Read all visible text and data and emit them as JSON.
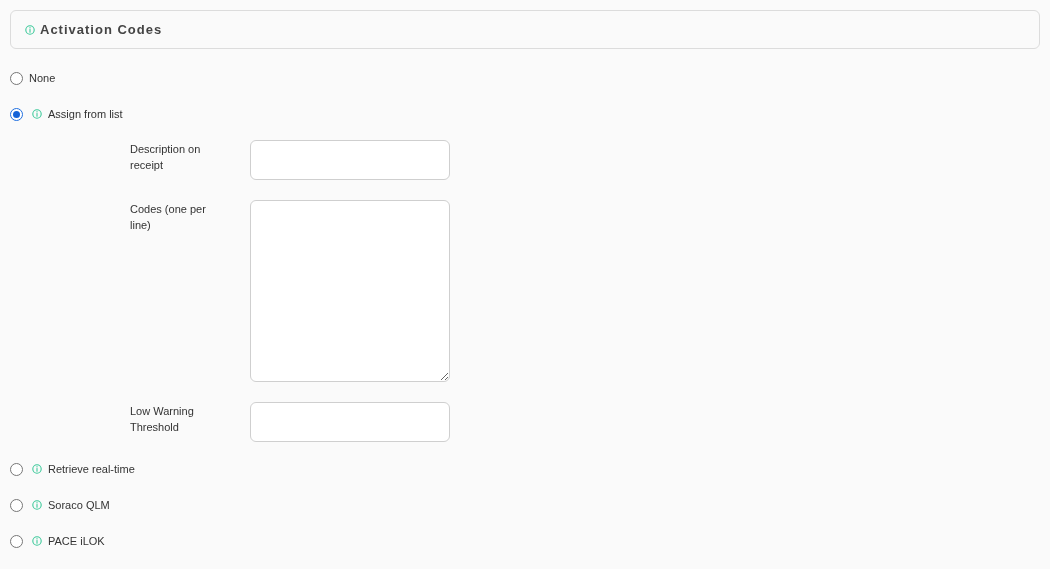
{
  "section": {
    "title": "Activation Codes",
    "info": true
  },
  "options": [
    {
      "label": "None",
      "info": false,
      "selected": false
    },
    {
      "label": "Assign from list",
      "info": true,
      "selected": true,
      "fields": [
        {
          "label": "Description on receipt",
          "kind": "input"
        },
        {
          "label": "Codes (one per line)",
          "kind": "textarea"
        },
        {
          "label": "Low Warning Threshold",
          "kind": "input"
        }
      ]
    },
    {
      "label": "Retrieve real-time",
      "info": true,
      "selected": false
    },
    {
      "label": "Soraco QLM",
      "info": true,
      "selected": false
    },
    {
      "label": "PACE iLOK",
      "info": true,
      "selected": false
    }
  ]
}
